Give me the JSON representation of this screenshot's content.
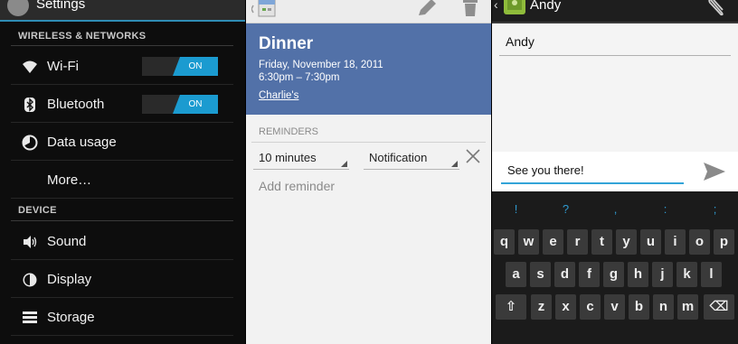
{
  "settings": {
    "title": "Settings",
    "section_wireless": "WIRELESS & NETWORKS",
    "section_device": "DEVICE",
    "items": {
      "wifi": "Wi-Fi",
      "bluetooth": "Bluetooth",
      "data_usage": "Data usage",
      "more": "More…",
      "sound": "Sound",
      "display": "Display",
      "storage": "Storage"
    },
    "toggle_on": "ON"
  },
  "calendar": {
    "event_title": "Dinner",
    "date": "Friday, November 18, 2011",
    "time": "6:30pm – 7:30pm",
    "calendar_owner": "Charlie's",
    "reminders_header": "REMINDERS",
    "reminder_time": "10 minutes",
    "reminder_method": "Notification",
    "add_reminder": "Add reminder"
  },
  "messaging": {
    "contact_name": "Andy",
    "to_value": "Andy",
    "message_text": "See you there!",
    "keyboard": {
      "symbols": [
        "!",
        "?",
        ",",
        ":",
        ";"
      ],
      "row1": [
        "q",
        "w",
        "e",
        "r",
        "t",
        "y",
        "u",
        "i",
        "o",
        "p"
      ],
      "row2": [
        "a",
        "s",
        "d",
        "f",
        "g",
        "h",
        "j",
        "k",
        "l"
      ],
      "row3": [
        "z",
        "x",
        "c",
        "v",
        "b",
        "n",
        "m"
      ]
    }
  },
  "colors": {
    "accent_blue": "#1b9bd0",
    "calendar_header": "#5271a8",
    "input_focus": "#33a4d8"
  }
}
